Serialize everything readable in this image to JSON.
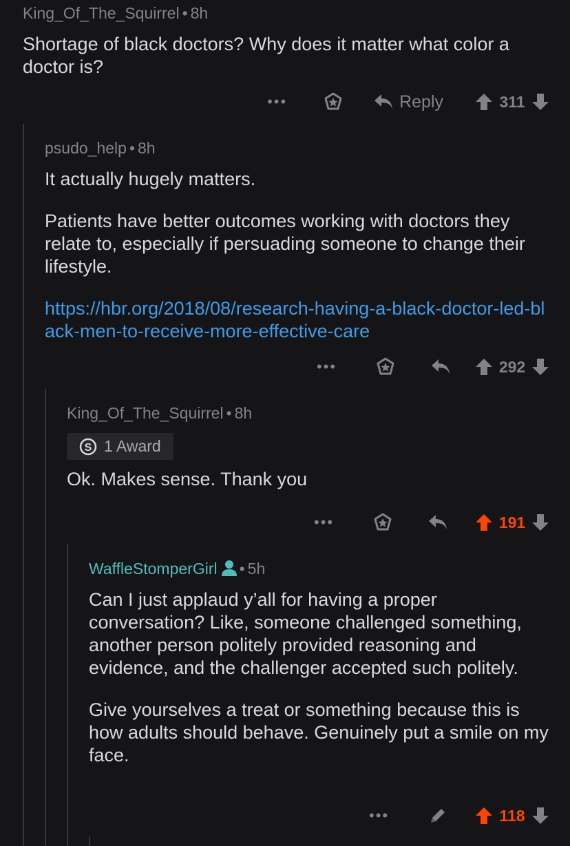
{
  "comments": [
    {
      "user": "King_Of_The_Squirrel",
      "time": "8h",
      "paragraphs": [
        "Shortage of black doctors?  Why does it matter what color a doctor is?"
      ],
      "more": "•••",
      "reply_label": "Reply",
      "score": "311",
      "upvoted": false
    },
    {
      "user": "psudo_help",
      "time": "8h",
      "paragraphs": [
        "It actually hugely matters.",
        "Patients have better outcomes working with doctors they relate to, especially if persuading someone to change their lifestyle."
      ],
      "link": "https://hbr.org/2018/08/research-having-a-black-doctor-led-black-men-to-receive-more-effective-care",
      "more": "•••",
      "score": "292",
      "upvoted": false
    },
    {
      "user": "King_Of_The_Squirrel",
      "time": "8h",
      "award": "1 Award",
      "paragraphs": [
        "Ok.  Makes sense. Thank you"
      ],
      "more": "•••",
      "score": "191",
      "upvoted": true
    },
    {
      "user": "WaffleStomperGirl",
      "time": "5h",
      "paragraphs": [
        "Can I just applaud y’all for having a proper conversation? Like, someone challenged something, another person politely provided reasoning and evidence, and the challenger accepted such politely.",
        "Give yourselves a treat or something because this is how adults should behave. Genuinely put a smile on my face."
      ],
      "more": "•••",
      "score": "118",
      "upvoted": true
    }
  ],
  "separator": "•",
  "colors": {
    "background": "#151517",
    "upvote": "#ff4500",
    "link": "#3d9ce8",
    "op_user": "#4fbdba",
    "muted": "#818384"
  }
}
